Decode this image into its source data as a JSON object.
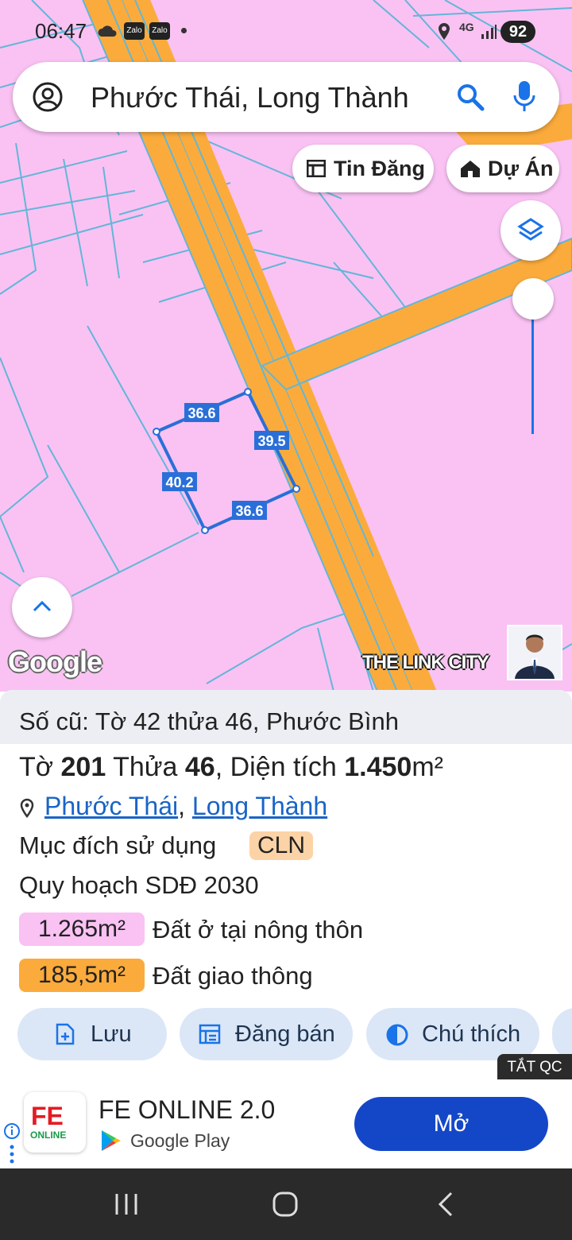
{
  "status_bar": {
    "time": "06:47",
    "zalo_1": "Zalo",
    "zalo_2": "Zalo",
    "network": "4G",
    "battery": "92"
  },
  "search": {
    "query": "Phước Thái, Long Thành"
  },
  "chips": {
    "listings": "Tin Đăng",
    "projects": "Dự Án"
  },
  "parcel_edges": {
    "top": "36.6",
    "right": "39.5",
    "left": "40.2",
    "bottom": "36.6"
  },
  "watermark": {
    "google": "Google",
    "brand": "THE LINK CITY"
  },
  "sheet": {
    "old_record": "Số cũ: Tờ 42 thửa 46, Phước Bình",
    "sheet_prefix": "Tờ ",
    "sheet_no": "201",
    "parcel_prefix": " Thửa ",
    "parcel_no": "46",
    "area_prefix": ", Diện tích ",
    "area_value": "1.450",
    "area_unit": "m²",
    "ward": "Phước Thái",
    "separator": ", ",
    "district": "Long Thành",
    "usage_label": "Mục đích sử dụng",
    "usage_code": "CLN",
    "plan_label": "Quy hoạch SDĐ 2030",
    "zones": [
      {
        "area": "1.265m²",
        "label": "Đất ở tại nông thôn",
        "color": "#f9c2f3"
      },
      {
        "area": "185,5m²",
        "label": "Đất giao thông",
        "color": "#fbab3c"
      }
    ],
    "actions": {
      "save": "Lưu",
      "post": "Đăng bán",
      "legend": "Chú thích"
    }
  },
  "ad": {
    "close_label": "TẮT QC",
    "title": "FE ONLINE 2.0",
    "store": "Google Play",
    "open_label": "Mở",
    "logo_top": "FE",
    "logo_bottom": "ONLINE"
  },
  "colors": {
    "land": "#f9c2f3",
    "road": "#fbab3c",
    "parcel_line": "#63b6d8",
    "selection": "#2a6fd8"
  }
}
